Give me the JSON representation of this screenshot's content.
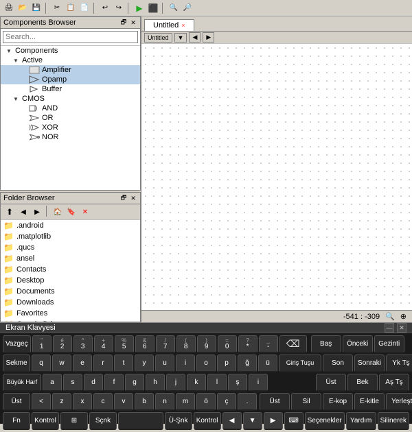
{
  "toolbar": {
    "buttons": [
      "🖨",
      "💾",
      "📁",
      "✂",
      "📋",
      "↩",
      "↪",
      "▶",
      "⬛"
    ]
  },
  "components_browser": {
    "title": "Components Browser",
    "search_placeholder": "Search...",
    "tree": [
      {
        "level": 1,
        "type": "group",
        "label": "Components",
        "expanded": true
      },
      {
        "level": 2,
        "type": "group",
        "label": "Active",
        "expanded": true
      },
      {
        "level": 3,
        "type": "item",
        "label": "Amplifier",
        "icon": "amplifier"
      },
      {
        "level": 3,
        "type": "item",
        "label": "Opamp",
        "icon": "opamp",
        "selected": true
      },
      {
        "level": 3,
        "type": "item",
        "label": "Buffer",
        "icon": "buffer"
      },
      {
        "level": 2,
        "type": "group",
        "label": "CMOS",
        "expanded": true
      },
      {
        "level": 3,
        "type": "item",
        "label": "AND",
        "icon": "gate"
      },
      {
        "level": 3,
        "type": "item",
        "label": "OR",
        "icon": "gate"
      },
      {
        "level": 3,
        "type": "item",
        "label": "XOR",
        "icon": "gate"
      },
      {
        "level": 3,
        "type": "item",
        "label": "NOR",
        "icon": "gate"
      }
    ]
  },
  "folder_browser": {
    "title": "Folder Browser",
    "folders": [
      ".android",
      ".matplotlib",
      ".qucs",
      "ansel",
      "Contacts",
      "Desktop",
      "Documents",
      "Downloads",
      "Favorites",
      "Google Drive"
    ]
  },
  "canvas": {
    "tab_label": "Untitled",
    "tab_close": "×",
    "nav_items": [
      "Untitled",
      "▼",
      "◀",
      "▶"
    ],
    "status": "-541 : -309"
  },
  "keyboard": {
    "title": "Ekran Klavyesi",
    "rows": [
      {
        "keys": [
          {
            "label": "Vazgeç",
            "special": true
          },
          {
            "top": "\"",
            "main": "1"
          },
          {
            "top": "é",
            "main": "2"
          },
          {
            "top": "^",
            "main": "3"
          },
          {
            "top": "+",
            "main": "4"
          },
          {
            "top": "%",
            "main": "5"
          },
          {
            "top": "&",
            "main": "6"
          },
          {
            "top": "/",
            "main": "7"
          },
          {
            "top": "(",
            "main": "8"
          },
          {
            "top": ")",
            "main": "9"
          },
          {
            "top": "=",
            "main": "0"
          },
          {
            "top": "?",
            "main": "*"
          },
          {
            "top": "_",
            "main": "-"
          },
          {
            "label": "⌫",
            "special": true
          },
          {
            "label": "Baş",
            "func": true
          },
          {
            "label": "Önceki",
            "func": true
          },
          {
            "label": "Gezinti",
            "func": true
          }
        ]
      },
      {
        "keys": [
          {
            "label": "Sekme",
            "special": true
          },
          {
            "main": "q"
          },
          {
            "main": "w"
          },
          {
            "main": "e"
          },
          {
            "main": "r"
          },
          {
            "main": "t"
          },
          {
            "main": "y"
          },
          {
            "main": "u"
          },
          {
            "main": "i"
          },
          {
            "main": "o"
          },
          {
            "main": "p"
          },
          {
            "top": "ğ",
            "main": "ğ"
          },
          {
            "top": "ü",
            "main": "ü"
          },
          {
            "label": "Giriş Tuşu",
            "special": true,
            "wide": true
          },
          {
            "label": "Son",
            "func": true
          },
          {
            "label": "Sonraki",
            "func": true
          },
          {
            "label": "Yk Tş",
            "func": true
          }
        ]
      },
      {
        "keys": [
          {
            "label": "Büyük Harf",
            "special": true,
            "wide": true
          },
          {
            "main": "a"
          },
          {
            "main": "s"
          },
          {
            "main": "d"
          },
          {
            "main": "f"
          },
          {
            "main": "g"
          },
          {
            "main": "h"
          },
          {
            "main": "j"
          },
          {
            "main": "k"
          },
          {
            "main": "l"
          },
          {
            "top": "ş",
            "main": "ş"
          },
          {
            "top": "i",
            "main": "i"
          },
          {
            "label": "Üst",
            "func": true
          },
          {
            "label": "Bek",
            "func": true
          },
          {
            "label": "Aş Tş",
            "func": true
          }
        ]
      },
      {
        "keys": [
          {
            "label": "Üst",
            "special": true
          },
          {
            "main": "<"
          },
          {
            "main": "z"
          },
          {
            "main": "x"
          },
          {
            "main": "c"
          },
          {
            "main": "v"
          },
          {
            "main": "b"
          },
          {
            "main": "n"
          },
          {
            "main": "m"
          },
          {
            "top": "ö",
            "main": "ö"
          },
          {
            "top": "ç",
            "main": "ç"
          },
          {
            "main": "·"
          },
          {
            "label": "Üst",
            "func": true
          },
          {
            "label": "Sil",
            "func": true
          },
          {
            "label": "E-kop",
            "func": true
          },
          {
            "label": "E-kitle",
            "func": true
          },
          {
            "label": "Yerleştir",
            "func": true
          }
        ]
      },
      {
        "keys": [
          {
            "label": "Fn",
            "special": true
          },
          {
            "label": "Kontrol",
            "special": true
          },
          {
            "label": "⊞",
            "special": true
          },
          {
            "label": "Sçnk",
            "special": true
          },
          {
            "label": "",
            "space": true
          },
          {
            "label": "Ü-Şnk",
            "special": true
          },
          {
            "label": "Kontrol",
            "special": true
          },
          {
            "main": "◀"
          },
          {
            "main": "▼"
          },
          {
            "main": "▶"
          },
          {
            "label": "⌨",
            "special": true
          },
          {
            "label": "Seçenekler",
            "func": true
          },
          {
            "label": "Yardım",
            "func": true
          },
          {
            "label": "Silinerek",
            "func": true
          }
        ]
      }
    ]
  }
}
